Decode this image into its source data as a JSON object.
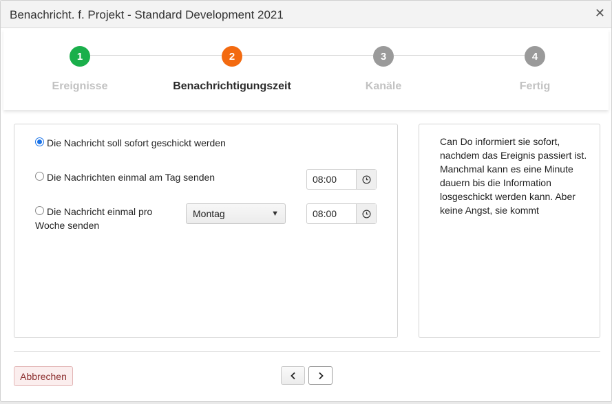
{
  "dialog": {
    "title": "Benachricht. f. Projekt - Standard Development 2021",
    "close_icon": "close-icon"
  },
  "wizard": {
    "steps": [
      {
        "number": "1",
        "label": "Ereignisse",
        "state": "done",
        "color": "#1aaf4b"
      },
      {
        "number": "2",
        "label": "Benachrichtigungszeit",
        "state": "active",
        "color": "#f36a10"
      },
      {
        "number": "3",
        "label": "Kanäle",
        "state": "pending",
        "color": "#9a9a9a"
      },
      {
        "number": "4",
        "label": "Fertig",
        "state": "pending",
        "color": "#9a9a9a"
      }
    ]
  },
  "options": {
    "selected": "immediate",
    "immediate_label": "Die Nachricht soll sofort geschickt werden",
    "daily_label": "Die Nachrichten einmal am Tag senden",
    "daily_time": "08:00",
    "weekly_label_line1": "Die Nachricht einmal pro",
    "weekly_label_line2": "Woche senden",
    "weekly_day": "Montag",
    "weekly_time": "08:00",
    "clock_icon": "clock-icon",
    "dropdown_icon": "triangle-down-icon"
  },
  "help": {
    "text": "Can Do informiert sie sofort, nachdem das Ereignis passiert ist. Manchmal kann es eine Minute dauern bis die Information losgeschickt werden kann. Aber keine Angst, sie kommt"
  },
  "footer": {
    "cancel_label": "Abbrechen",
    "prev_icon": "chevron-left-icon",
    "next_icon": "chevron-right-icon"
  }
}
